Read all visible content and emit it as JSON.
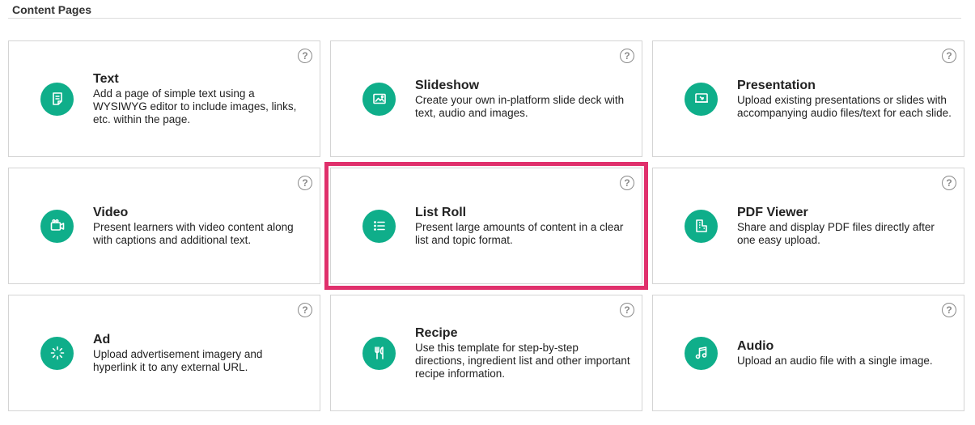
{
  "section": {
    "title": "Content Pages"
  },
  "help_glyph": "?",
  "cards": [
    {
      "title": "Text",
      "desc": "Add a page of simple text using a WYSIWYG editor to include images, links, etc. within the page.",
      "icon": "document-icon",
      "selected": false
    },
    {
      "title": "Slideshow",
      "desc": "Create your own in-platform slide deck with text, audio and images.",
      "icon": "image-icon",
      "selected": false
    },
    {
      "title": "Presentation",
      "desc": "Upload existing presentations or slides with accompanying audio files/text for each slide.",
      "icon": "presentation-icon",
      "selected": false
    },
    {
      "title": "Video",
      "desc": "Present learners with video content along with captions and additional text.",
      "icon": "video-camera-icon",
      "selected": false
    },
    {
      "title": "List Roll",
      "desc": "Present large amounts of content in a clear list and topic format.",
      "icon": "list-icon",
      "selected": true
    },
    {
      "title": "PDF Viewer",
      "desc": "Share and display PDF files directly after one easy upload.",
      "icon": "building-icon",
      "selected": false
    },
    {
      "title": "Ad",
      "desc": "Upload advertisement imagery and hyperlink it to any external URL.",
      "icon": "sparkle-icon",
      "selected": false
    },
    {
      "title": "Recipe",
      "desc": "Use this template for step-by-step directions, ingredient list and other important recipe information.",
      "icon": "utensils-icon",
      "selected": false
    },
    {
      "title": "Audio",
      "desc": "Upload an audio file with a single image.",
      "icon": "music-note-icon",
      "selected": false
    }
  ],
  "colors": {
    "accent": "#0fae8a",
    "selection": "#e0306c",
    "border": "#d4d4d4"
  }
}
